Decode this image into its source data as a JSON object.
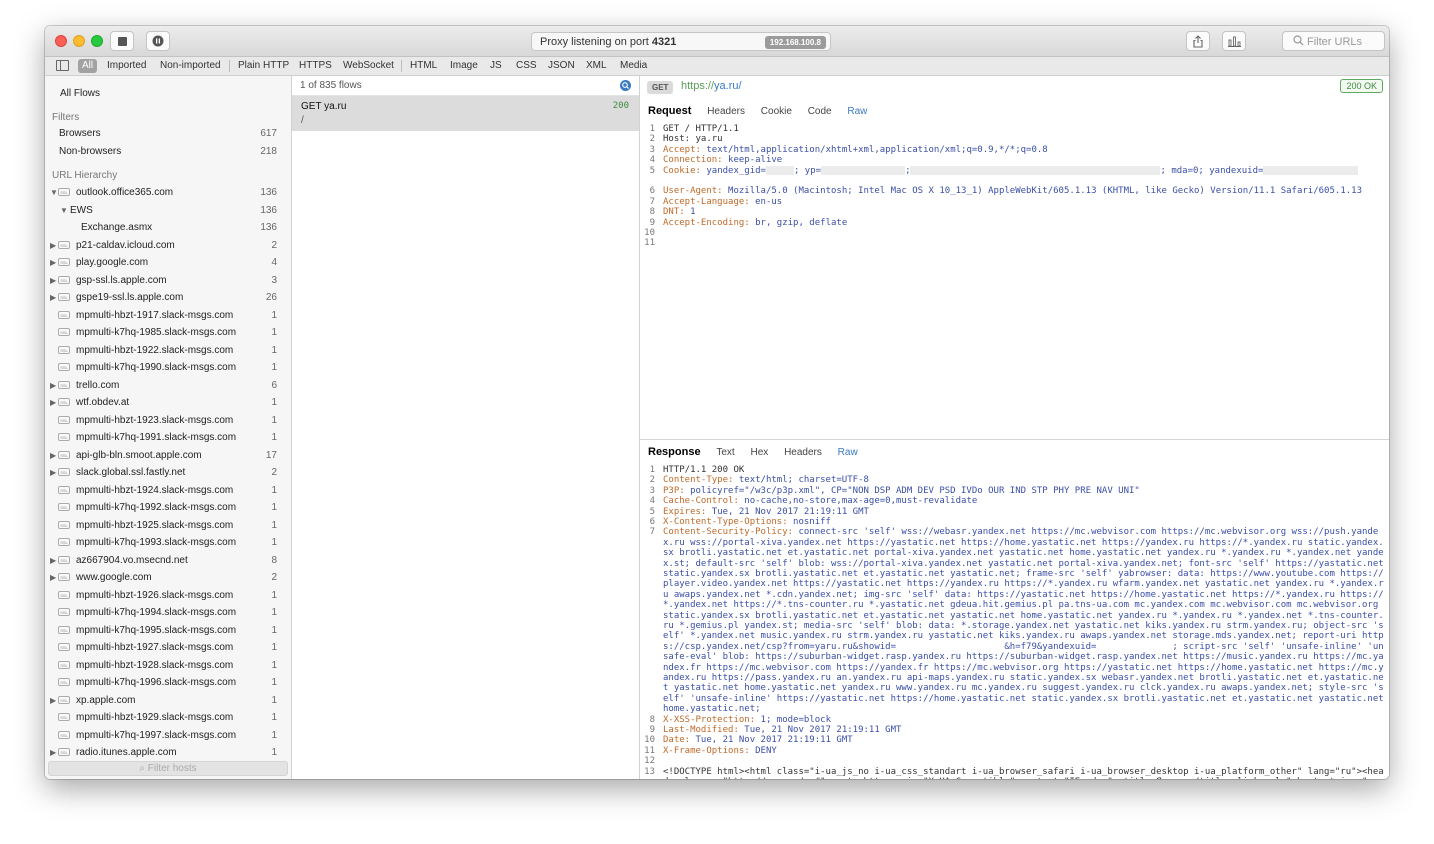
{
  "window": {
    "status_text_prefix": "Proxy listening on port ",
    "status_port": "4321",
    "ip_badge": "192.168.100.8",
    "filter_urls_placeholder": "Filter URLs"
  },
  "filter_tabs": [
    "All",
    "Imported",
    "Non-imported",
    "Plain HTTP",
    "HTTPS",
    "WebSocket",
    "HTML",
    "Image",
    "JS",
    "CSS",
    "JSON",
    "XML",
    "Media"
  ],
  "sidebar": {
    "all_flows": "All Flows",
    "filters_heading": "Filters",
    "filters": [
      {
        "label": "Browsers",
        "count": "617"
      },
      {
        "label": "Non-browsers",
        "count": "218"
      }
    ],
    "hierarchy_heading": "URL Hierarchy",
    "ssl_label": "SSL",
    "hosts": [
      {
        "label": "outlook.office365.com",
        "count": "136",
        "arrow": "▼",
        "ssl": true,
        "indent": 0
      },
      {
        "label": "EWS",
        "count": "136",
        "arrow": "▼",
        "ssl": false,
        "indent": 1
      },
      {
        "label": "Exchange.asmx",
        "count": "136",
        "arrow": "",
        "ssl": false,
        "indent": 2
      },
      {
        "label": "p21-caldav.icloud.com",
        "count": "2",
        "arrow": "▶",
        "ssl": true,
        "indent": 0
      },
      {
        "label": "play.google.com",
        "count": "4",
        "arrow": "▶",
        "ssl": true,
        "indent": 0
      },
      {
        "label": "gsp-ssl.ls.apple.com",
        "count": "3",
        "arrow": "▶",
        "ssl": true,
        "indent": 0
      },
      {
        "label": "gspe19-ssl.ls.apple.com",
        "count": "26",
        "arrow": "▶",
        "ssl": true,
        "indent": 0
      },
      {
        "label": "mpmulti-hbzt-1917.slack-msgs.com",
        "count": "1",
        "arrow": "",
        "ssl": true,
        "indent": 0
      },
      {
        "label": "mpmulti-k7hq-1985.slack-msgs.com",
        "count": "1",
        "arrow": "",
        "ssl": true,
        "indent": 0
      },
      {
        "label": "mpmulti-hbzt-1922.slack-msgs.com",
        "count": "1",
        "arrow": "",
        "ssl": true,
        "indent": 0
      },
      {
        "label": "mpmulti-k7hq-1990.slack-msgs.com",
        "count": "1",
        "arrow": "",
        "ssl": true,
        "indent": 0
      },
      {
        "label": "trello.com",
        "count": "6",
        "arrow": "▶",
        "ssl": true,
        "indent": 0
      },
      {
        "label": "wtf.obdev.at",
        "count": "1",
        "arrow": "▶",
        "ssl": true,
        "indent": 0
      },
      {
        "label": "mpmulti-hbzt-1923.slack-msgs.com",
        "count": "1",
        "arrow": "",
        "ssl": true,
        "indent": 0
      },
      {
        "label": "mpmulti-k7hq-1991.slack-msgs.com",
        "count": "1",
        "arrow": "",
        "ssl": true,
        "indent": 0
      },
      {
        "label": "api-glb-bln.smoot.apple.com",
        "count": "17",
        "arrow": "▶",
        "ssl": true,
        "indent": 0
      },
      {
        "label": "slack.global.ssl.fastly.net",
        "count": "2",
        "arrow": "▶",
        "ssl": true,
        "indent": 0
      },
      {
        "label": "mpmulti-hbzt-1924.slack-msgs.com",
        "count": "1",
        "arrow": "",
        "ssl": true,
        "indent": 0
      },
      {
        "label": "mpmulti-k7hq-1992.slack-msgs.com",
        "count": "1",
        "arrow": "",
        "ssl": true,
        "indent": 0
      },
      {
        "label": "mpmulti-hbzt-1925.slack-msgs.com",
        "count": "1",
        "arrow": "",
        "ssl": true,
        "indent": 0
      },
      {
        "label": "mpmulti-k7hq-1993.slack-msgs.com",
        "count": "1",
        "arrow": "",
        "ssl": true,
        "indent": 0
      },
      {
        "label": "az667904.vo.msecnd.net",
        "count": "8",
        "arrow": "▶",
        "ssl": true,
        "indent": 0
      },
      {
        "label": "www.google.com",
        "count": "2",
        "arrow": "▶",
        "ssl": true,
        "indent": 0
      },
      {
        "label": "mpmulti-hbzt-1926.slack-msgs.com",
        "count": "1",
        "arrow": "",
        "ssl": true,
        "indent": 0
      },
      {
        "label": "mpmulti-k7hq-1994.slack-msgs.com",
        "count": "1",
        "arrow": "",
        "ssl": true,
        "indent": 0
      },
      {
        "label": "mpmulti-k7hq-1995.slack-msgs.com",
        "count": "1",
        "arrow": "",
        "ssl": true,
        "indent": 0
      },
      {
        "label": "mpmulti-hbzt-1927.slack-msgs.com",
        "count": "1",
        "arrow": "",
        "ssl": true,
        "indent": 0
      },
      {
        "label": "mpmulti-hbzt-1928.slack-msgs.com",
        "count": "1",
        "arrow": "",
        "ssl": true,
        "indent": 0
      },
      {
        "label": "mpmulti-k7hq-1996.slack-msgs.com",
        "count": "1",
        "arrow": "",
        "ssl": true,
        "indent": 0
      },
      {
        "label": "xp.apple.com",
        "count": "1",
        "arrow": "▶",
        "ssl": true,
        "indent": 0
      },
      {
        "label": "mpmulti-hbzt-1929.slack-msgs.com",
        "count": "1",
        "arrow": "",
        "ssl": true,
        "indent": 0
      },
      {
        "label": "mpmulti-k7hq-1997.slack-msgs.com",
        "count": "1",
        "arrow": "",
        "ssl": true,
        "indent": 0
      },
      {
        "label": "radio.itunes.apple.com",
        "count": "1",
        "arrow": "▶",
        "ssl": true,
        "indent": 0
      }
    ],
    "filter_hosts_placeholder": "Filter hosts"
  },
  "flows": {
    "summary": "1 of 835 flows",
    "items": [
      {
        "title": "GET ya.ru",
        "path": "/",
        "status": "200"
      }
    ]
  },
  "detail": {
    "method": "GET",
    "url_scheme": "https://",
    "url_rest": "ya.ru/",
    "status_badge": "200 OK",
    "request_heading": "Request",
    "request_tabs": [
      "Headers",
      "Cookie",
      "Code",
      "Raw"
    ],
    "request_lines": [
      {
        "n": "1",
        "k": "",
        "v": "",
        "m": "GET / HTTP/1.1"
      },
      {
        "n": "2",
        "k": "",
        "v": "",
        "m": "Host: ya.ru"
      },
      {
        "n": "3",
        "k": "Accept: ",
        "v": "text/html,application/xhtml+xml,application/xml;q=0.9,*/*;q=0.8",
        "m": ""
      },
      {
        "n": "4",
        "k": "Connection: ",
        "v": "keep-alive",
        "m": ""
      },
      {
        "n": "5",
        "k": "Cookie: ",
        "v": "yandex_gid=",
        "m": "",
        "cookie": true,
        "c1": "; yp=",
        "c2": ";",
        "c3": "; mda=0; yandexuid="
      },
      {
        "n": "6",
        "k": "User-Agent: ",
        "v": "Mozilla/5.0 (Macintosh; Intel Mac OS X 10_13_1) AppleWebKit/605.1.13 (KHTML, like Gecko) Version/11.1 Safari/605.1.13",
        "m": ""
      },
      {
        "n": "7",
        "k": "Accept-Language: ",
        "v": "en-us",
        "m": ""
      },
      {
        "n": "8",
        "k": "DNT: ",
        "v": "1",
        "m": ""
      },
      {
        "n": "9",
        "k": "Accept-Encoding: ",
        "v": "br, gzip, deflate",
        "m": ""
      },
      {
        "n": "10",
        "k": "",
        "v": "",
        "m": ""
      },
      {
        "n": "11",
        "k": "",
        "v": "",
        "m": ""
      }
    ],
    "response_heading": "Response",
    "response_tabs": [
      "Text",
      "Hex",
      "Headers",
      "Raw"
    ],
    "response_lines": [
      {
        "n": "1",
        "k": "",
        "v": "",
        "m": "HTTP/1.1 200 OK"
      },
      {
        "n": "2",
        "k": "Content-Type: ",
        "v": "text/html; charset=UTF-8",
        "m": ""
      },
      {
        "n": "3",
        "k": "P3P: ",
        "v": "policyref=\"/w3c/p3p.xml\", CP=\"NON DSP ADM DEV PSD IVDo OUR IND STP PHY PRE NAV UNI\"",
        "m": ""
      },
      {
        "n": "4",
        "k": "Cache-Control: ",
        "v": "no-cache,no-store,max-age=0,must-revalidate",
        "m": ""
      },
      {
        "n": "5",
        "k": "Expires: ",
        "v": "Tue, 21 Nov 2017 21:19:11 GMT",
        "m": ""
      },
      {
        "n": "6",
        "k": "X-Content-Type-Options: ",
        "v": "nosniff",
        "m": ""
      },
      {
        "n": "7",
        "k": "Content-Security-Policy: ",
        "v": "connect-src 'self' wss://webasr.yandex.net https://mc.webvisor.com https://mc.webvisor.org wss://push.yandex.ru wss://portal-xiva.yandex.net https://yastatic.net https://home.yastatic.net https://yandex.ru https://*.yandex.ru static.yandex.sx brotli.yastatic.net et.yastatic.net portal-xiva.yandex.net yastatic.net home.yastatic.net yandex.ru *.yandex.ru *.yandex.net yandex.st; default-src 'self' blob: wss://portal-xiva.yandex.net yastatic.net portal-xiva.yandex.net; font-src 'self' https://yastatic.net static.yandex.sx brotli.yastatic.net et.yastatic.net yastatic.net; frame-src 'self' yabrowser: data: https://www.youtube.com https://player.video.yandex.net https://yastatic.net https://yandex.ru https://*.yandex.ru wfarm.yandex.net yastatic.net yandex.ru *.yandex.ru awaps.yandex.net *.cdn.yandex.net; img-src 'self' data: https://yastatic.net https://home.yastatic.net https://*.yandex.ru https://*.yandex.net https://*.tns-counter.ru *.yastatic.net gdeua.hit.gemius.pl pa.tns-ua.com mc.yandex.com mc.webvisor.com mc.webvisor.org static.yandex.sx brotli.yastatic.net et.yastatic.net yastatic.net home.yastatic.net yandex.ru *.yandex.ru *.yandex.net *.tns-counter.ru *.gemius.pl yandex.st; media-src 'self' blob: data: *.storage.yandex.net yastatic.net kiks.yandex.ru strm.yandex.ru; object-src 'self' *.yandex.net music.yandex.ru strm.yandex.ru yastatic.net kiks.yandex.ru awaps.yandex.net storage.mds.yandex.net; report-uri https://csp.yandex.net/csp?from=yaru.ru&showid=                    &h=f79&yandexuid=              ; script-src 'self' 'unsafe-inline' 'unsafe-eval' blob: https://suburban-widget.rasp.yandex.ru https://suburban-widget.rasp.yandex.net https://music.yandex.ru https://mc.yandex.fr https://mc.webvisor.com https://yandex.fr https://mc.webvisor.org https://yastatic.net https://home.yastatic.net https://mc.yandex.ru https://pass.yandex.ru an.yandex.ru api-maps.yandex.ru static.yandex.sx webasr.yandex.net brotli.yastatic.net et.yastatic.net yastatic.net home.yastatic.net yandex.ru www.yandex.ru mc.yandex.ru suggest.yandex.ru clck.yandex.ru awaps.yandex.net; style-src 'self' 'unsafe-inline' https://yastatic.net https://home.yastatic.net static.yandex.sx brotli.yastatic.net et.yastatic.net yastatic.net home.yastatic.net;",
        "m": ""
      },
      {
        "n": "8",
        "k": "X-XSS-Protection: ",
        "v": "1; mode=block",
        "m": ""
      },
      {
        "n": "9",
        "k": "Last-Modified: ",
        "v": "Tue, 21 Nov 2017 21:19:11 GMT",
        "m": ""
      },
      {
        "n": "10",
        "k": "Date: ",
        "v": "Tue, 21 Nov 2017 21:19:11 GMT",
        "m": ""
      },
      {
        "n": "11",
        "k": "X-Frame-Options: ",
        "v": "DENY",
        "m": ""
      },
      {
        "n": "12",
        "k": "",
        "v": "",
        "m": ""
      },
      {
        "n": "13",
        "k": "",
        "v": "",
        "m": "<!DOCTYPE html><html class=\"i-ua_js_no i-ua_css_standart i-ua_browser_safari i-ua_browser_desktop i-ua_platform_other\" lang=\"ru\"><head xmlns:og=\"http://ogp.me/ns#\"><meta http-equiv=\"X-UA-Compatible\" content=\"IE=edge\"><title>Яндекс</title><link rel=\"shortcut icon\""
      }
    ]
  },
  "colors": {
    "accent": "#3a7ac6",
    "header_key": "#c06a2a",
    "header_value": "#3b4fa6",
    "status_ok": "#3f8a3f",
    "close": "#fc5f57",
    "minimize": "#fdbc2e",
    "zoom": "#28c840"
  },
  "icons": [
    "sidebar-toggle-icon",
    "stop-icon",
    "pause-icon",
    "share-icon",
    "chart-icon",
    "search-icon"
  ]
}
